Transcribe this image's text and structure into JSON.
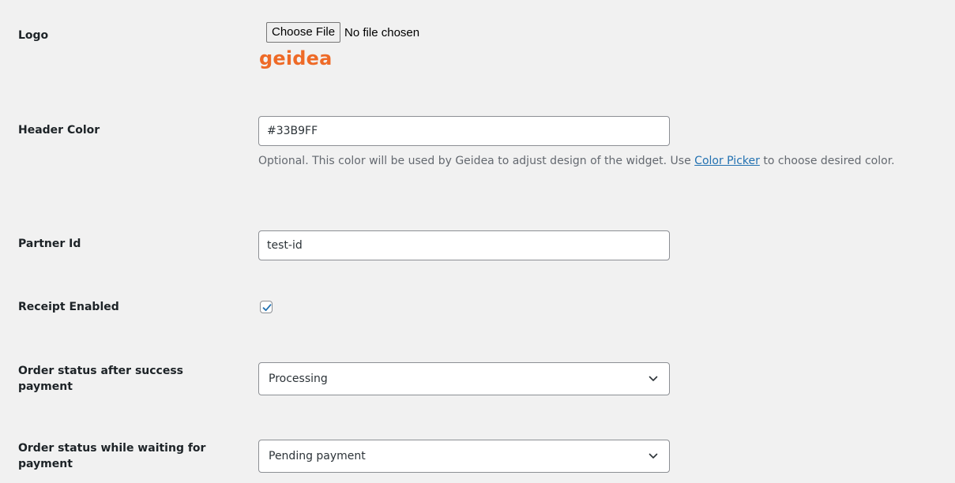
{
  "logo": {
    "label": "Logo",
    "file_button": "Choose File",
    "file_status": "No file chosen",
    "brand_text": "geidea",
    "brand_color": "#ee6a27"
  },
  "header_color": {
    "label": "Header Color",
    "value": "#33B9FF",
    "description_before": "Optional. This color will be used by Geidea to adjust design of the widget. Use ",
    "description_link": "Color Picker",
    "description_after": " to choose desired color."
  },
  "partner_id": {
    "label": "Partner Id",
    "value": "test-id"
  },
  "receipt_enabled": {
    "label": "Receipt Enabled",
    "checked": true
  },
  "order_status_success": {
    "label": "Order status after success payment",
    "selected": "Processing"
  },
  "order_status_waiting": {
    "label": "Order status while waiting for payment",
    "selected": "Pending payment"
  },
  "colors": {
    "link": "#2271b1",
    "checkbox_check": "#2271b1",
    "background": "#f1f1f1"
  }
}
